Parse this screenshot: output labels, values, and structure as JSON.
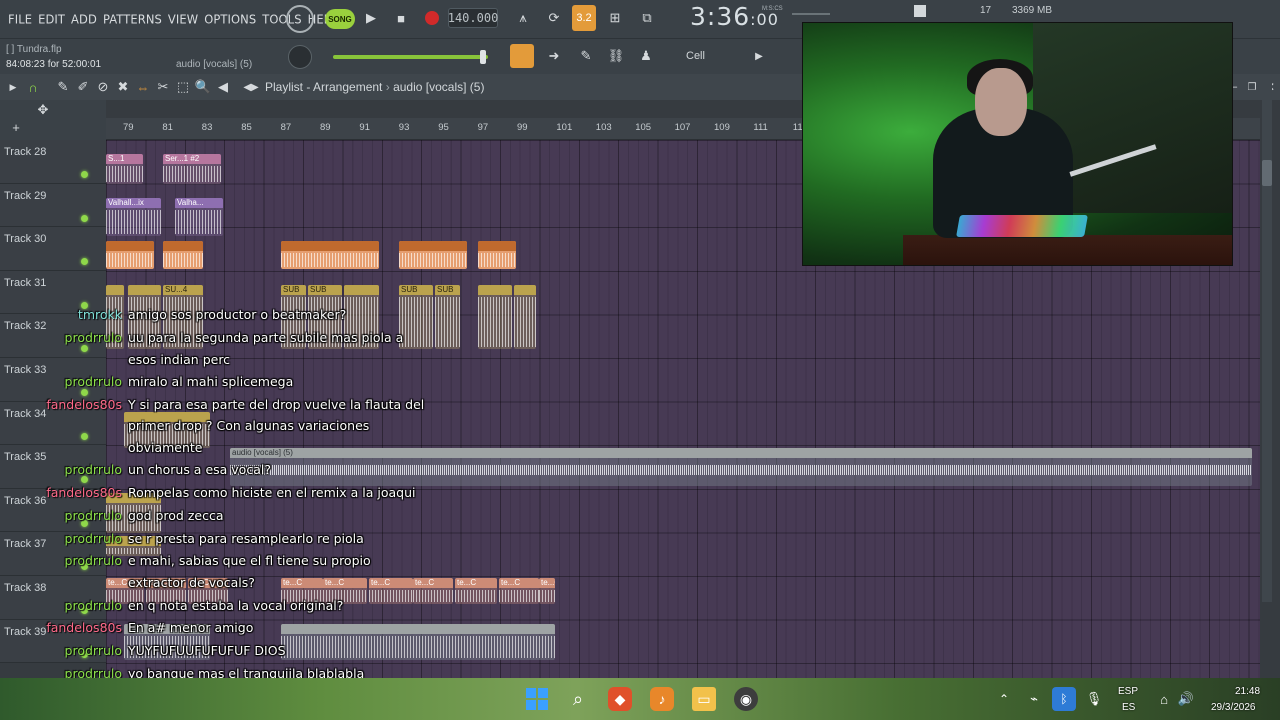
{
  "menubar": {
    "items": [
      "FILE",
      "EDIT",
      "ADD",
      "PATTERNS",
      "VIEW",
      "OPTIONS",
      "TOOLS",
      "HELP"
    ],
    "song_mode": "SONG",
    "tempo": "140.000",
    "time": "3:36",
    "time_ms": ":00",
    "time_unit": "M:S:CS",
    "cpu": "17",
    "memory": "3369 MB",
    "pattern_label": "3.2"
  },
  "infobar": {
    "project_file": "[  ] Tundra.flp",
    "project_time": "84:08:23 for 52:00:01",
    "hint": "audio [vocals] (5)",
    "snap": "Cell"
  },
  "playlist": {
    "title": "Playlist - Arrangement",
    "breadcrumb": "audio [vocals] (5)",
    "ruler": [
      "79",
      "81",
      "83",
      "85",
      "87",
      "89",
      "91",
      "93",
      "95",
      "97",
      "99",
      "101",
      "103",
      "105",
      "107",
      "109",
      "111",
      "11"
    ],
    "tracks": [
      "Track 28",
      "Track 29",
      "Track 30",
      "Track 31",
      "Track 32",
      "Track 33",
      "Track 34",
      "Track 35",
      "Track 36",
      "Track 37",
      "Track 38",
      "Track 39"
    ],
    "clips": {
      "t28a": "S...1",
      "t28b": "Ser...1 #2",
      "t29a": "Valhall...ix",
      "t29b": "Valha...",
      "sub": "SUB",
      "sub_short": "SU...4",
      "vocals": "audio [vocals] (5)",
      "te": "te...C"
    }
  },
  "chat": [
    {
      "user": "tmrokk",
      "color": "#7fe0d8",
      "msg": "amigo sos productor o beatmaker?"
    },
    {
      "user": "prodrrulo",
      "color": "#8be04a",
      "msg": "uu para la segunda parte subile mas piola a"
    },
    {
      "user": "",
      "color": "#8be04a",
      "msg": "esos indian perc"
    },
    {
      "user": "prodrrulo",
      "color": "#8be04a",
      "msg": "miralo al mahi splicemega"
    },
    {
      "user": "fandelos80s",
      "color": "#ff6a8a",
      "msg": "Y si para esa parte del drop vuelve la flauta del"
    },
    {
      "user": "",
      "color": "#ff6a8a",
      "msg": "primer drop ? Con algunas variaciones"
    },
    {
      "user": "",
      "color": "#ff6a8a",
      "msg": "obviamente"
    },
    {
      "user": "prodrrulo",
      "color": "#8be04a",
      "msg": "un chorus a esa vocal?"
    },
    {
      "user": "fandelos80s",
      "color": "#ff6a8a",
      "msg": "Rompelas como hiciste en el remix a la joaqui"
    },
    {
      "user": "prodrrulo",
      "color": "#8be04a",
      "msg": "god prod zecca"
    },
    {
      "user": "prodrrulo",
      "color": "#8be04a",
      "msg": "se r presta para resamplearlo re piola"
    },
    {
      "user": "prodrrulo",
      "color": "#8be04a",
      "msg": "e mahi, sabias que el fl tiene su propio"
    },
    {
      "user": "",
      "color": "#8be04a",
      "msg": "extractor de vocals?"
    },
    {
      "user": "prodrrulo",
      "color": "#8be04a",
      "msg": "en q nota estaba la vocal original?"
    },
    {
      "user": "fandelos80s",
      "color": "#ff6a8a",
      "msg": "En a# menor amigo"
    },
    {
      "user": "prodrrulo",
      "color": "#8be04a",
      "msg": "YUYFUFUUFUFUFUF DIOS"
    },
    {
      "user": "prodrrulo",
      "color": "#8be04a",
      "msg": "yo banque mas el tranquiila blablabla"
    }
  ],
  "taskbar": {
    "lang_top": "ESP",
    "lang_bottom": "ES",
    "clock_time": "21:48",
    "clock_date": "29/3/2026"
  },
  "colors": {
    "accent_green": "#8fd84a",
    "accent_orange": "#e39b3a",
    "playlist_bg": "#473a54"
  }
}
